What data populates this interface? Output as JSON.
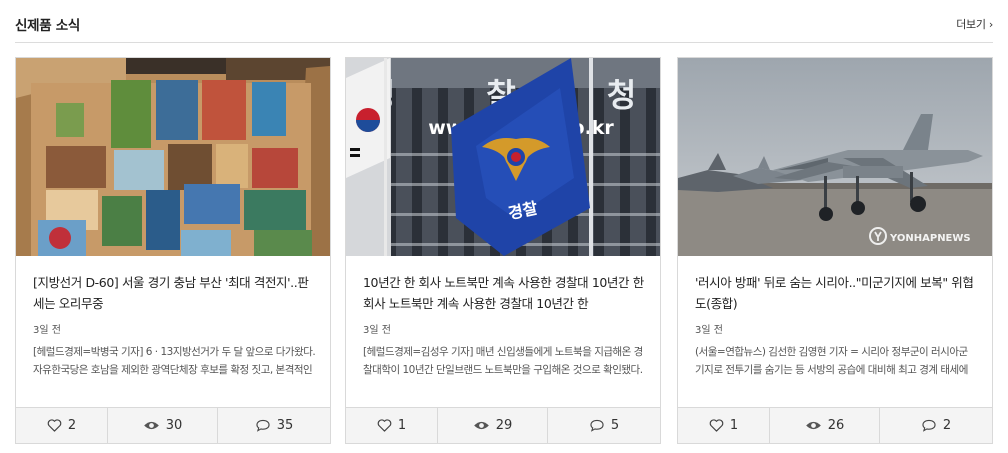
{
  "section": {
    "title": "신제품 소식",
    "more_label": "더보기 ›"
  },
  "cards": [
    {
      "title": "[지방선거 D-60] 서울 경기 충남 부산 '최대 격전지'..판세는 오리무중",
      "date": "3일 전",
      "summary": "[헤럴드경제=박병국 기자] 6 · 13지방선거가 두 달 앞으로 다가왔다. 자유한국당은 호남을 제외한 광역단체장 후보를 확정 짓고, 본격적인 선거운동에 들어갔으며 더불어민주당도",
      "likes": "2",
      "views": "30",
      "comments": "35"
    },
    {
      "title": "10년간 한 회사 노트북만 계속 사용한 경찰대 10년간 한 회사 노트북만 계속 사용한 경찰대 10년간 한",
      "date": "3일 전",
      "summary": "[헤럴드경제=김성우 기자] 매년 신입생들에게 노트북을 지급해온 경찰대학이 10년간 단일브랜드 노트북만을 구입해온 것으로 확인됐다. 여기에 경찰대 측은 \"국가계약을 통해 ..",
      "likes": "1",
      "views": "29",
      "comments": "5",
      "image_text": {
        "building_sign": "경 찰 청",
        "url_sign": "www.police.go.kr",
        "flag_text": "경찰"
      }
    },
    {
      "title": "'러시아 방패' 뒤로 숨는 시리아..\"미군기지에 보복\" 위협도(종합)",
      "date": "3일 전",
      "summary": "(서울=연합뉴스) 김선한 김영현 기자 = 시리아 정부군이 러시아군 기지로 전투기를 숨기는 등 서방의 공습에 대비해 최고 경계 태세에 돌입했다. 바샤르 알아사드 시리아 대통령",
      "likes": "1",
      "views": "26",
      "comments": "2",
      "image_text": {
        "watermark": "YONHAPNEWS"
      }
    }
  ]
}
